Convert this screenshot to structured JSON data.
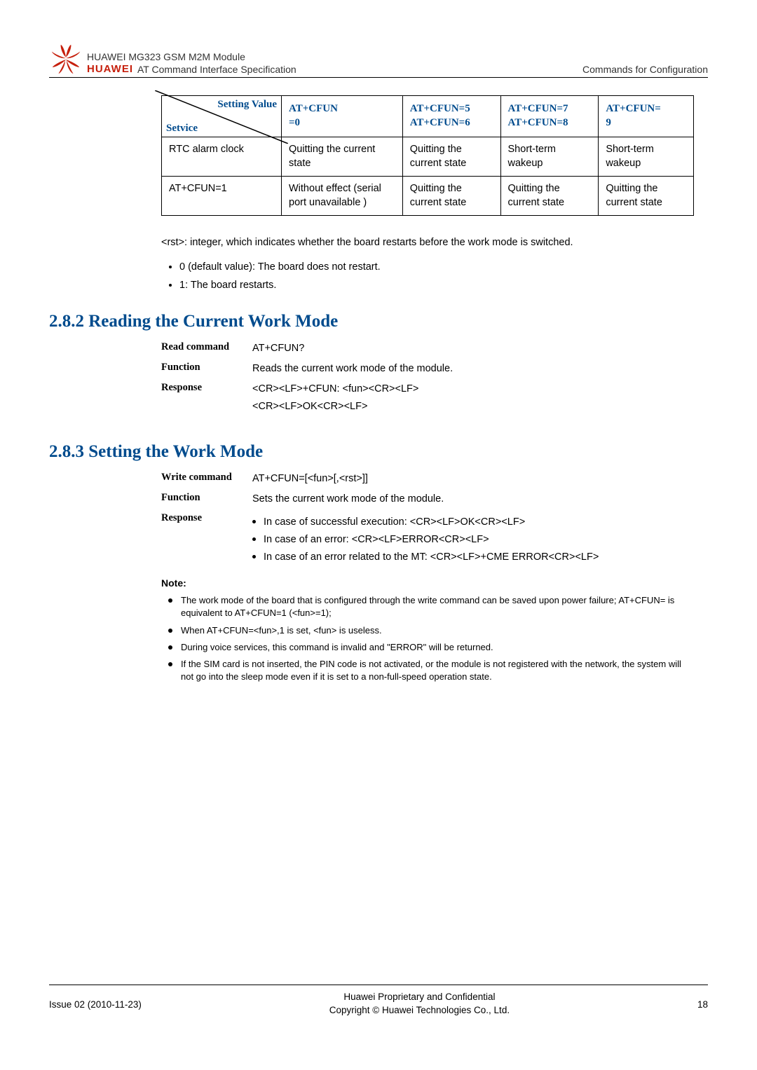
{
  "header": {
    "line1": "HUAWEI MG323 GSM M2M Module",
    "line2": "AT Command Interface Specification",
    "right": "Commands for Configuration",
    "brand": "HUAWEI"
  },
  "table": {
    "head": {
      "diag_top": "Setting Value",
      "diag_bot": "Setvice",
      "c1a": "AT+CFUN",
      "c1b": "=0",
      "c2a": "AT+CFUN=5",
      "c2b": "AT+CFUN=6",
      "c3a": "AT+CFUN=7",
      "c3b": "AT+CFUN=8",
      "c4a": "AT+CFUN=",
      "c4b": "9"
    },
    "rows": [
      {
        "c0": "RTC alarm clock",
        "c1": "Quitting the current state",
        "c2": "Quitting the current state",
        "c3": "Short-term wakeup",
        "c4": "Short-term wakeup"
      },
      {
        "c0": "AT+CFUN=1",
        "c1": "Without effect (serial port unavailable )",
        "c2": "Quitting the current state",
        "c3": "Quitting the current state",
        "c4": "Quitting the current state"
      }
    ]
  },
  "rst_para": "<rst>: integer, which indicates whether the board restarts before the work mode is switched.",
  "rst_bullets": [
    "0 (default value): The board does not restart.",
    "1: The board restarts."
  ],
  "sec282": {
    "title": "2.8.2 Reading the Current Work Mode",
    "rows": {
      "read_k": "Read command",
      "read_v": "AT+CFUN?",
      "func_k": "Function",
      "func_v": "Reads the current work mode of the module.",
      "resp_k": "Response",
      "resp_v1": "<CR><LF>+CFUN: <fun><CR><LF>",
      "resp_v2": "<CR><LF>OK<CR><LF>"
    }
  },
  "sec283": {
    "title": "2.8.3 Setting the Work Mode",
    "rows": {
      "write_k": "Write command",
      "write_v": "AT+CFUN=[<fun>[,<rst>]]",
      "func_k": "Function",
      "func_v": "Sets the current work mode of the module.",
      "resp_k": "Response",
      "resp_b1": "In case of successful execution: <CR><LF>OK<CR><LF>",
      "resp_b2": "In case of an error: <CR><LF>ERROR<CR><LF>",
      "resp_b3": "In case of an error related to the MT: <CR><LF>+CME ERROR<CR><LF>"
    },
    "note_label": "Note:",
    "notes": [
      "The work mode of the board that is configured through the write command can be saved upon power failure; AT+CFUN= is equivalent to AT+CFUN=1 (<fun>=1);",
      "When AT+CFUN=<fun>,1 is set, <fun> is useless.",
      "During voice services, this command is invalid and \"ERROR\" will be returned.",
      "If the SIM card is not inserted, the PIN code is not activated, or the module is not registered with the network, the system will not go into the sleep mode even if it is set to a non-full-speed operation state."
    ]
  },
  "footer": {
    "left": "Issue 02 (2010-11-23)",
    "mid1": "Huawei Proprietary and Confidential",
    "mid2": "Copyright © Huawei Technologies Co., Ltd.",
    "right": "18"
  }
}
